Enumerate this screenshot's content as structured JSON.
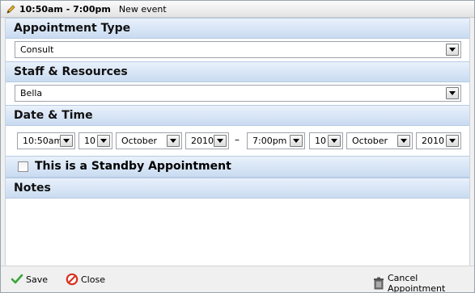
{
  "title": {
    "time": "10:50am - 7:00pm",
    "subtitle": "New event"
  },
  "sections": {
    "appointment_type": "Appointment Type",
    "staff": "Staff & Resources",
    "datetime": "Date & Time",
    "notes": "Notes"
  },
  "appointment_type_value": "Consult",
  "staff_value": "Bella",
  "start": {
    "time": "10:50am",
    "day": "10",
    "month": "October",
    "year": "2010"
  },
  "separator": "–",
  "end": {
    "time": "7:00pm",
    "day": "10",
    "month": "October",
    "year": "2010"
  },
  "standby": {
    "label": "This is a Standby Appointment",
    "checked": false
  },
  "notes_value": "",
  "footer": {
    "save": "Save",
    "close": "Close",
    "cancel": "Cancel Appointment"
  },
  "colors": {
    "section_bg": "#c9dbf1",
    "save_green": "#3aa53a",
    "close_red": "#d8321f"
  }
}
